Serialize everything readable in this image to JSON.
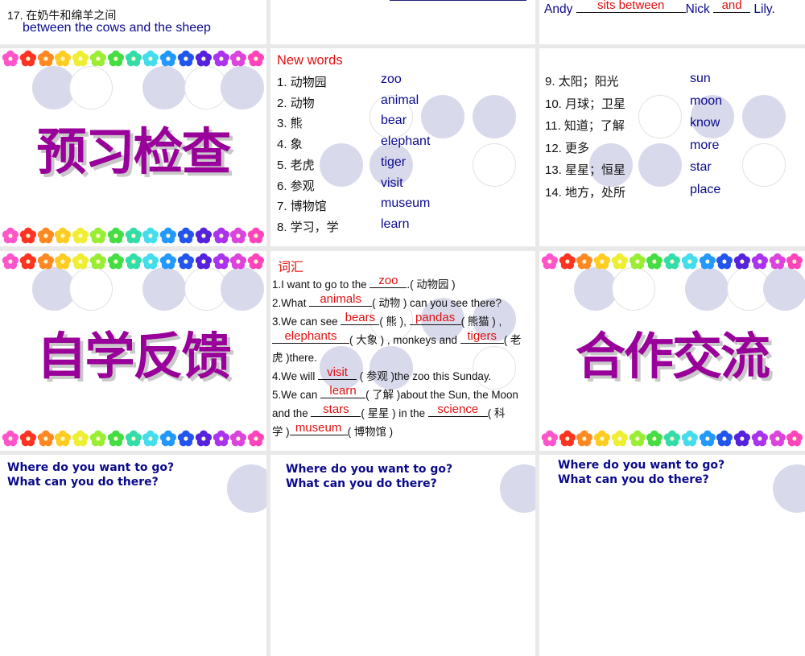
{
  "slides": {
    "top_left": {
      "item_cn": "17. 在奶牛和绵羊之间",
      "item_en": "between the cows and the sheep"
    },
    "top_right": {
      "sentence_start": "Andy",
      "answer1": "sits between",
      "mid": "Nick",
      "answer2": "and",
      "end": "Lily."
    },
    "preview_check": {
      "title": "预习检查"
    },
    "new_words_1": {
      "heading": "New words",
      "items": [
        {
          "cn": "1. 动物园",
          "en": "zoo"
        },
        {
          "cn": "2. 动物",
          "en": "animal"
        },
        {
          "cn": "3. 熊",
          "en": "bear"
        },
        {
          "cn": "4. 象",
          "en": "elephant"
        },
        {
          "cn": "5. 老虎",
          "en": "tiger"
        },
        {
          "cn": "6. 参观",
          "en": "visit"
        },
        {
          "cn": "7. 博物馆",
          "en": "museum"
        },
        {
          "cn": "8. 学习，学",
          "en": "learn"
        }
      ]
    },
    "new_words_2": {
      "items": [
        {
          "cn": "9. 太阳；阳光",
          "en": "sun"
        },
        {
          "cn": "10. 月球；卫星",
          "en": "moon"
        },
        {
          "cn": "11. 知道；了解",
          "en": "know"
        },
        {
          "cn": "12. 更多",
          "en": "more"
        },
        {
          "cn": "13. 星星；恒星",
          "en": "star"
        },
        {
          "cn": "14. 地方，处所",
          "en": "place"
        }
      ]
    },
    "self_study": {
      "title": "自学反馈"
    },
    "vocab_exercise": {
      "heading": "词汇",
      "l1a": "1.I want to go to the",
      "a1": "zoo",
      "l1b": ".( 动物园 )",
      "l2a": "2.What",
      "a2": "animals",
      "l2b": "( 动物 ) can you see there?",
      "l3a": "3.We can see",
      "a3": "bears",
      "l3b": "( 熊 ),",
      "a4": "pandas",
      "l3c": "( 熊猫 ) ,",
      "a5": "elephants",
      "l4b": "( 大象 ) , monkeys and",
      "a6": "tigers",
      "l4c": "( 老",
      "l5": "虎 )there.",
      "l6a": "4.We will",
      "a7": "visit",
      "l6b": "( 参观 )the zoo this Sunday.",
      "l7a": "5.We can",
      "a8": "learn",
      "l7b": "( 了解 )about the Sun, the Moon",
      "l8a": "and the",
      "a9": "stars",
      "l8b": "( 星星 ) in the",
      "a10": "science",
      "l8c": "( 科",
      "l9a": "学 )",
      "a11": "museum",
      "l9b": "( 博物馆 )"
    },
    "cooperation": {
      "title": "合作交流"
    },
    "bottom": {
      "q1": "Where do you want to go?",
      "q2": "What can you do there?"
    }
  },
  "colors": {
    "question_blue": "#0a0a8c",
    "answer_red": "#e01010",
    "title_purple": "#990099",
    "circle_fill": "#d9d9ec"
  }
}
